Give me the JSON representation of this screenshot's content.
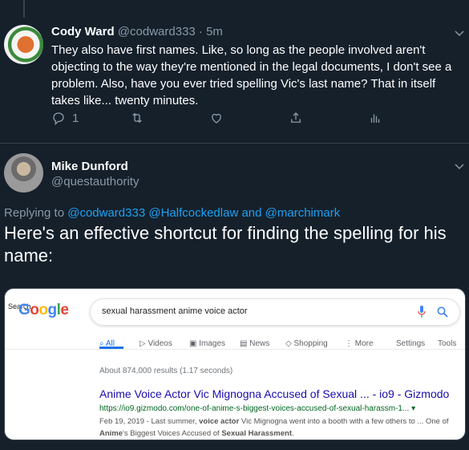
{
  "tweet1": {
    "name": "Cody Ward",
    "handle": "@codward333",
    "sep": "·",
    "time": "5m",
    "text": "They also have first names.  Like, so long as the people involved aren't objecting to the way they're mentioned in the legal documents, I don't see a problem.  Also, have you ever tried spelling Vic's last name?  That in itself takes like... twenty minutes.",
    "reply_count": "1"
  },
  "tweet2": {
    "name": "Mike Dunford",
    "handle": "@questauthority",
    "replying_prefix": "Replying to",
    "replying_to": [
      "@codward333",
      "@Halfcockedlaw",
      "@marchimark"
    ],
    "replying_and": "and",
    "text": "Here's an effective shortcut for finding the spelling for his name:"
  },
  "card": {
    "search_tag": "Search",
    "logo_text": "Google",
    "query": "sexual harassment anime voice actor",
    "tabs": [
      "All",
      "Videos",
      "Images",
      "News",
      "Shopping",
      "More",
      "Settings",
      "Tools"
    ],
    "stats": "About 874,000 results (1.17 seconds)",
    "result_title": "Anime Voice Actor Vic Mignogna Accused of Sexual ... - io9 - Gizmodo",
    "result_url": "https://io9.gizmodo.com/one-of-anime-s-biggest-voices-accused-of-sexual-harassm-1...",
    "snippet_date": "Feb 19, 2019",
    "snippet_a": " - Last summer, ",
    "snippet_b1": "voice actor",
    "snippet_c": " Vic Mignogna went into a booth with a few others to ... One of ",
    "snippet_b2": "Anime",
    "snippet_d": "'s Biggest Voices Accused of ",
    "snippet_b3": "Sexual Harassment",
    "snippet_e": "."
  },
  "colors": {
    "background": "#15202b",
    "link": "#1da1f2",
    "secondary": "#8899a6"
  },
  "icons": [
    "chevron-down-icon",
    "reply-icon",
    "retweet-icon",
    "like-icon",
    "share-icon",
    "analytics-icon",
    "mic-icon",
    "search-icon"
  ]
}
